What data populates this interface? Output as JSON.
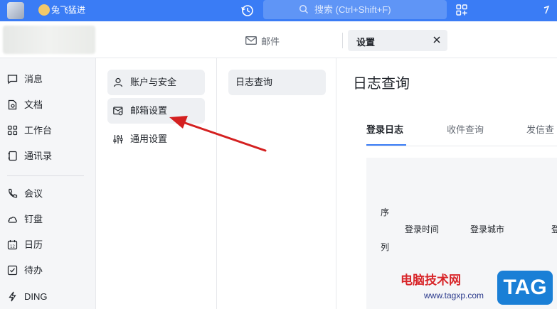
{
  "topbar": {
    "user_name": "兔飞猛进",
    "search_placeholder": "搜索 (Ctrl+Shift+F)",
    "brand_color": "#3a7cf5"
  },
  "tabs": {
    "mail_label": "邮件",
    "settings_label": "设置"
  },
  "leftnav": {
    "items": [
      {
        "label": "消息",
        "icon": "chat-icon"
      },
      {
        "label": "文档",
        "icon": "document-icon"
      },
      {
        "label": "工作台",
        "icon": "grid-icon"
      },
      {
        "label": "通讯录",
        "icon": "contacts-icon"
      },
      {
        "label": "会议",
        "icon": "phone-icon"
      },
      {
        "label": "钉盘",
        "icon": "cloud-icon"
      },
      {
        "label": "日历",
        "icon": "calendar-icon"
      },
      {
        "label": "待办",
        "icon": "checkbox-icon"
      },
      {
        "label": "DING",
        "icon": "lightning-icon"
      }
    ]
  },
  "settings_menu": {
    "items": [
      {
        "label": "账户与安全",
        "icon": "user-icon"
      },
      {
        "label": "邮箱设置",
        "icon": "mailbox-settings-icon"
      },
      {
        "label": "通用设置",
        "icon": "sliders-icon"
      }
    ]
  },
  "sub_menu": {
    "items": [
      {
        "label": "日志查询"
      }
    ]
  },
  "content": {
    "title": "日志查询",
    "tabs": [
      "登录日志",
      "收件查询",
      "发信查"
    ],
    "table_headers": {
      "index_top": "序",
      "index_bottom": "列",
      "login_time": "登录时间",
      "login_city": "登录城市",
      "cut_col": "登"
    }
  },
  "watermark": {
    "site_name": "电脑技术网",
    "url": "www.tagxp.com",
    "badge": "TAG"
  }
}
